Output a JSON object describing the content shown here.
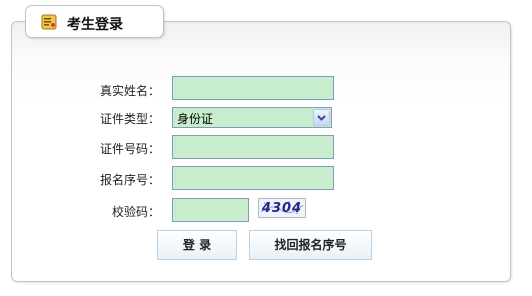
{
  "header": {
    "title": "考生登录",
    "icon": "login-badge-icon"
  },
  "form": {
    "name": {
      "label": "真实姓名：",
      "value": ""
    },
    "id_type": {
      "label": "证件类型：",
      "value": "身份证"
    },
    "id_number": {
      "label": "证件号码：",
      "value": ""
    },
    "reg_number": {
      "label": "报名序号：",
      "value": ""
    },
    "captcha": {
      "label": "校验码：",
      "value": "",
      "image_text": "4304"
    }
  },
  "buttons": {
    "login": "登 录",
    "recover": "找回报名序号"
  },
  "colors": {
    "field_bg": "#c7edcc",
    "field_border": "#7f9db9",
    "panel_border": "#c4c4c4"
  }
}
